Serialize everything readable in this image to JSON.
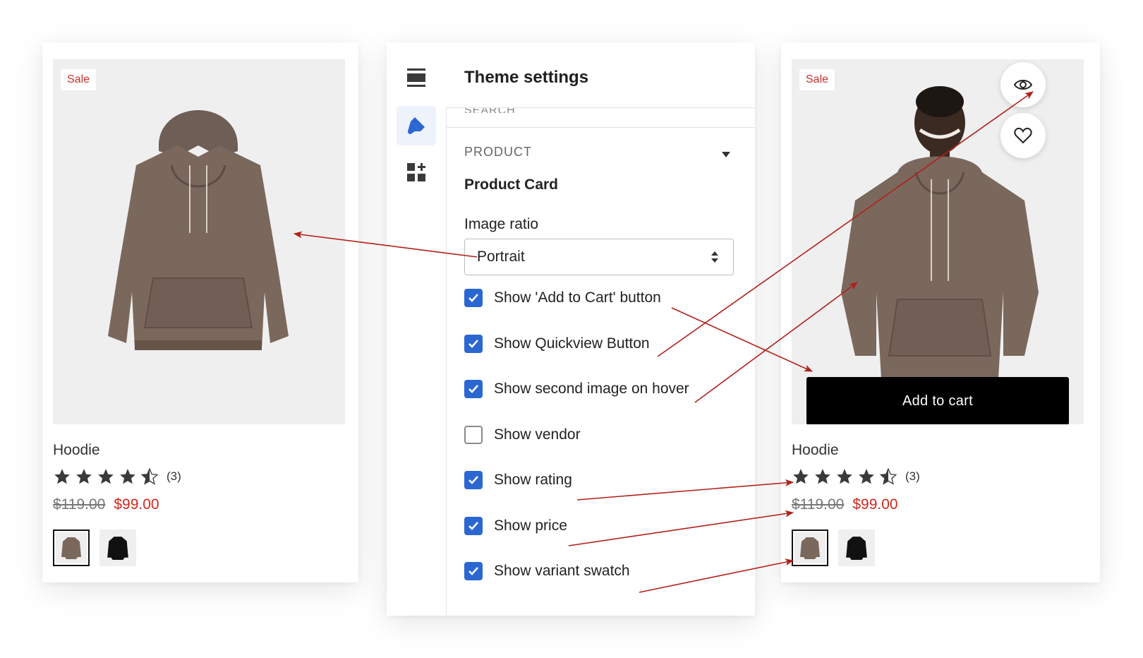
{
  "left_card": {
    "badge": "Sale",
    "title": "Hoodie",
    "rating_count": "(3)",
    "rating_value": 4.5,
    "old_price": "$119.00",
    "new_price": "$99.00"
  },
  "right_card": {
    "badge": "Sale",
    "title": "Hoodie",
    "rating_count": "(3)",
    "rating_value": 4.5,
    "old_price": "$119.00",
    "new_price": "$99.00",
    "add_to_cart": "Add to cart"
  },
  "panel": {
    "title": "Theme settings",
    "search_ghost": "SEARCH",
    "section": "PRODUCT",
    "subsection": "Product Card",
    "image_ratio_label": "Image ratio",
    "image_ratio_value": "Portrait",
    "checkboxes": [
      {
        "label": "Show 'Add to Cart' button",
        "checked": true
      },
      {
        "label": "Show Quickview Button",
        "checked": true
      },
      {
        "label": "Show second image on hover",
        "checked": true
      },
      {
        "label": "Show vendor",
        "checked": false
      },
      {
        "label": "Show rating",
        "checked": true
      },
      {
        "label": "Show price",
        "checked": true
      },
      {
        "label": "Show variant swatch",
        "checked": true
      }
    ]
  },
  "colors": {
    "accent_blue": "#2b67d1",
    "sale_red": "#d0281e",
    "arrow_red": "#b0201a"
  },
  "icons": [
    "layout-sections-icon",
    "paint-brush-icon",
    "apps-add-icon",
    "eye-icon",
    "heart-icon",
    "star-icon",
    "chevron-down-icon",
    "select-arrows-icon",
    "checkmark-icon"
  ]
}
